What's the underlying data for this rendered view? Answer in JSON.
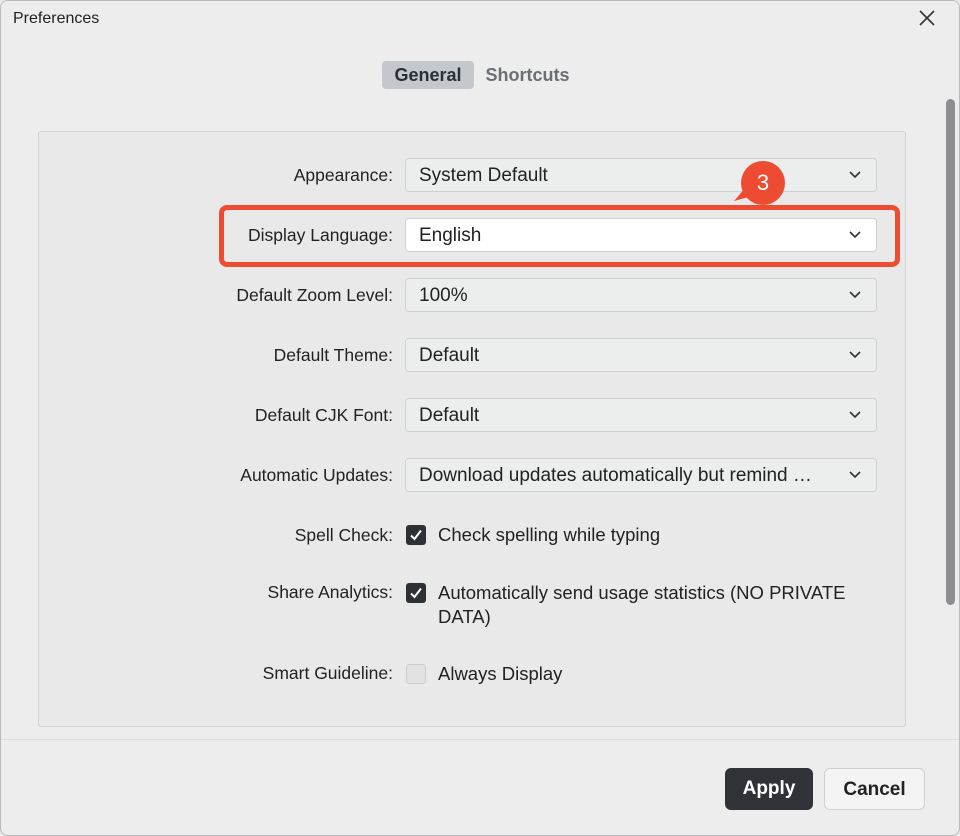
{
  "window": {
    "title": "Preferences"
  },
  "tabs": [
    {
      "label": "General",
      "active": true
    },
    {
      "label": "Shortcuts",
      "active": false
    }
  ],
  "settings": {
    "appearance": {
      "label": "Appearance:",
      "value": "System Default"
    },
    "display_language": {
      "label": "Display Language:",
      "value": "English"
    },
    "default_zoom": {
      "label": "Default Zoom Level:",
      "value": "100%"
    },
    "default_theme": {
      "label": "Default Theme:",
      "value": "Default"
    },
    "default_cjk_font": {
      "label": "Default CJK Font:",
      "value": "Default"
    },
    "automatic_updates": {
      "label": "Automatic Updates:",
      "value": "Download updates automatically but remind …"
    },
    "spell_check": {
      "label": "Spell Check:",
      "text": "Check spelling while typing",
      "checked": true
    },
    "share_analytics": {
      "label": "Share Analytics:",
      "text": "Automatically send usage statistics (NO PRIVATE DATA)",
      "checked": true
    },
    "smart_guideline": {
      "label": "Smart Guideline:",
      "text": "Always Display",
      "checked": false
    }
  },
  "annotation": {
    "step_number": "3",
    "color": "#ee4c32"
  },
  "buttons": {
    "apply": "Apply",
    "cancel": "Cancel"
  },
  "icons": {
    "close": "close-icon",
    "dropdown": "chevron-down-icon",
    "check": "checkmark-icon"
  }
}
